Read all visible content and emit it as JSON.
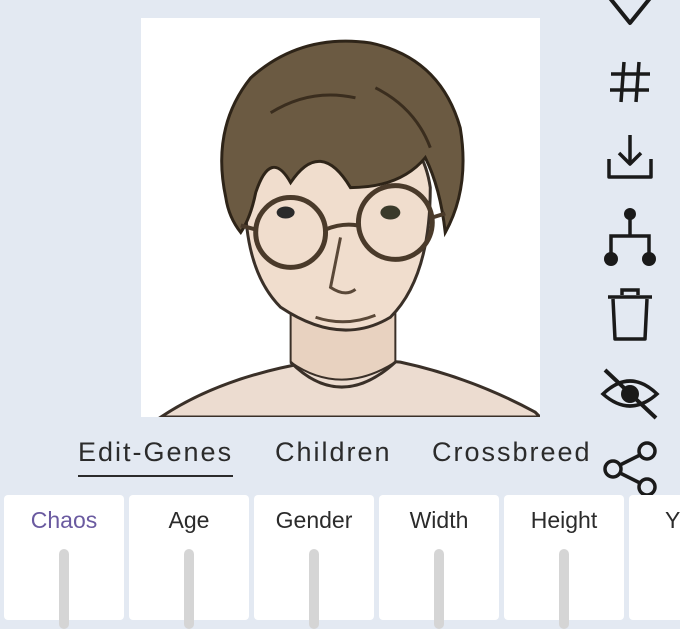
{
  "tabs": {
    "edit_genes": "Edit-Genes",
    "children": "Children",
    "crossbreed": "Crossbreed"
  },
  "genes": {
    "chaos": "Chaos",
    "age": "Age",
    "gender": "Gender",
    "width": "Width",
    "height": "Height",
    "next": "Y"
  },
  "icons": [
    "heart-icon",
    "hashtag-icon",
    "download-icon",
    "family-tree-icon",
    "trash-icon",
    "hide-icon",
    "share-icon"
  ],
  "colors": {
    "background": "#e3e9f2",
    "selected_gene": "#6a5aa0",
    "icon": "#1a1a1a"
  }
}
